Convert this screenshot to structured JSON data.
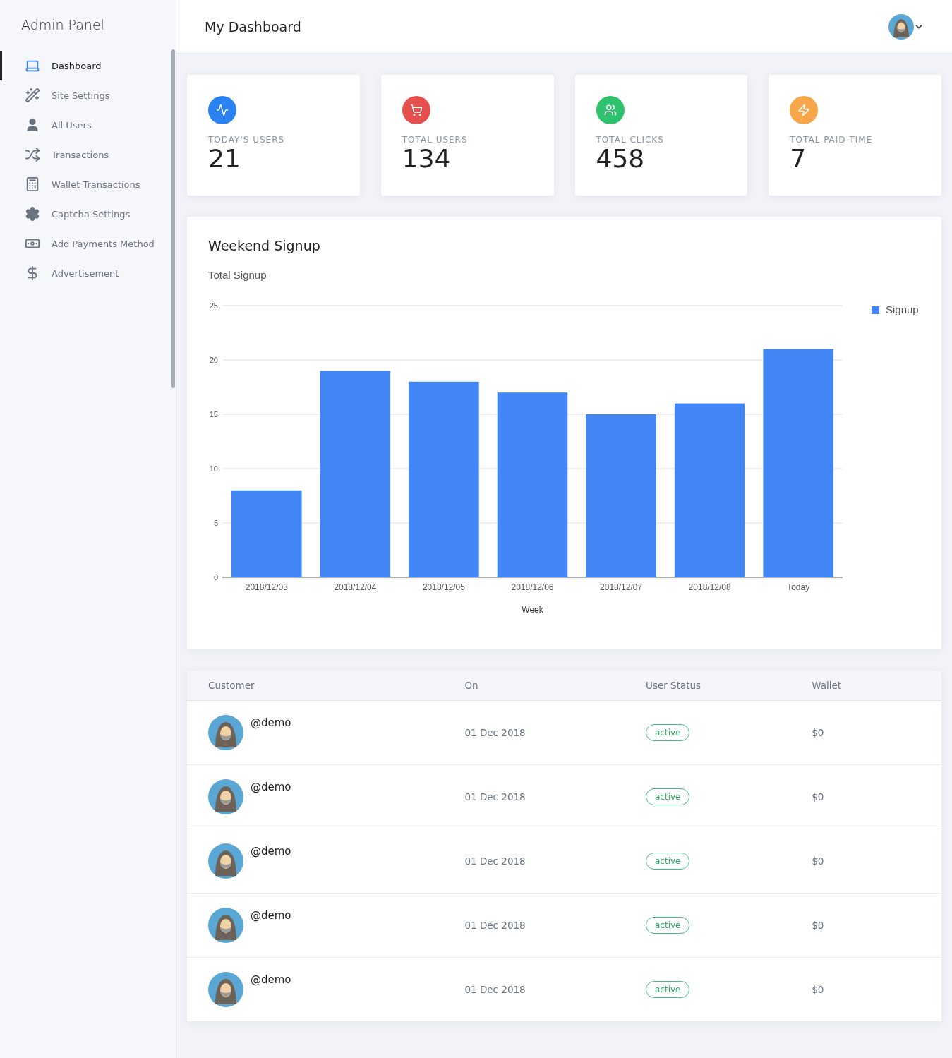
{
  "sidebar": {
    "title": "Admin Panel",
    "items": [
      {
        "label": "Dashboard",
        "selected": true
      },
      {
        "label": "Site Settings",
        "selected": false
      },
      {
        "label": "All Users",
        "selected": false
      },
      {
        "label": "Transactions",
        "selected": false
      },
      {
        "label": "Wallet Transactions",
        "selected": false
      },
      {
        "label": "Captcha Settings",
        "selected": false
      },
      {
        "label": "Add Payments Method",
        "selected": false
      },
      {
        "label": "Advertisement",
        "selected": false
      }
    ]
  },
  "header": {
    "title": "My Dashboard"
  },
  "stats": [
    {
      "label": "TODAY'S USERS",
      "value": "21",
      "color": "#2a81f0"
    },
    {
      "label": "TOTAL USERS",
      "value": "134",
      "color": "#e5504f"
    },
    {
      "label": "TOTAL CLICKS",
      "value": "458",
      "color": "#2fc26e"
    },
    {
      "label": "TOTAL PAID TIME",
      "value": "7",
      "color": "#f7a74a"
    }
  ],
  "chart_card": {
    "title": "Weekend Signup",
    "chart_data": {
      "type": "bar",
      "title": "Total Signup",
      "xlabel": "Week",
      "categories": [
        "2018/12/03",
        "2018/12/04",
        "2018/12/05",
        "2018/12/06",
        "2018/12/07",
        "2018/12/08",
        "Today"
      ],
      "series": [
        {
          "name": "Signup",
          "color": "#4285f4",
          "values": [
            8,
            19,
            18,
            17,
            15,
            16,
            21
          ]
        }
      ],
      "ylim": [
        0,
        25
      ],
      "yticks": [
        0,
        5,
        10,
        15,
        20,
        25
      ],
      "grid": true
    }
  },
  "table": {
    "columns": [
      "Customer",
      "On",
      "User Status",
      "Wallet"
    ],
    "rows": [
      {
        "customer": "@demo",
        "on": "01 Dec 2018",
        "status": "active",
        "wallet": "$0"
      },
      {
        "customer": "@demo",
        "on": "01 Dec 2018",
        "status": "active",
        "wallet": "$0"
      },
      {
        "customer": "@demo",
        "on": "01 Dec 2018",
        "status": "active",
        "wallet": "$0"
      },
      {
        "customer": "@demo",
        "on": "01 Dec 2018",
        "status": "active",
        "wallet": "$0"
      },
      {
        "customer": "@demo",
        "on": "01 Dec 2018",
        "status": "active",
        "wallet": "$0"
      }
    ]
  }
}
